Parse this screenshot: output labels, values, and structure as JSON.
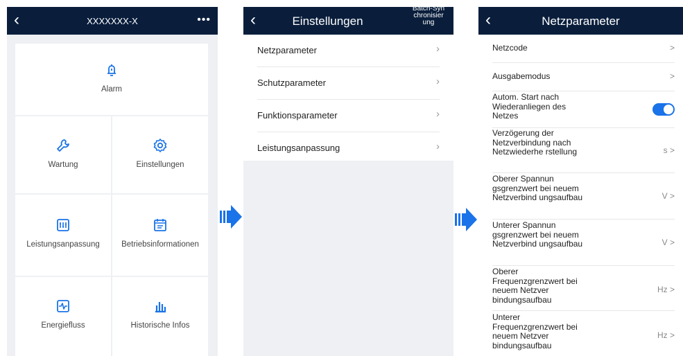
{
  "screen1": {
    "title": "XXXXXXX-X",
    "more_label": "•••",
    "tiles": [
      {
        "label": "Alarm",
        "icon": "alarm-bell-icon"
      },
      {
        "label": "Wartung",
        "icon": "wrench-icon"
      },
      {
        "label": "Einstellungen",
        "icon": "gear-icon"
      },
      {
        "label": "Leistungsanpassung",
        "icon": "sliders-icon"
      },
      {
        "label": "Betriebsinformationen",
        "icon": "calendar-icon"
      },
      {
        "label": "Energiefluss",
        "icon": "pulse-icon"
      },
      {
        "label": "Historische Infos",
        "icon": "bar-chart-icon"
      }
    ]
  },
  "screen2": {
    "title": "Einstellungen",
    "batch_label": "Batch-Syn chronisier ung",
    "items": [
      {
        "label": "Netzparameter"
      },
      {
        "label": "Schutzparameter"
      },
      {
        "label": "Funktionsparameter"
      },
      {
        "label": "Leistungsanpassung"
      }
    ]
  },
  "screen3": {
    "title": "Netzparameter",
    "items": [
      {
        "label": "Netzcode",
        "suffix": ">"
      },
      {
        "label": "Ausgabemodus",
        "suffix": ">"
      },
      {
        "label": "Autom. Start nach Wiederanliegen des Netzes",
        "suffix": "",
        "toggle_on": true
      },
      {
        "label": "Verzögerung der Netzverbindung nach Netzwiederhe rstellung",
        "suffix": "s >"
      },
      {
        "label": "Oberer Spannun gsgrenzwert bei neuem Netzverbind ungsaufbau",
        "suffix": "V >"
      },
      {
        "label": "Unterer Spannun gsgrenzwert bei neuem Netzverbind ungsaufbau",
        "suffix": "V >"
      },
      {
        "label": "Oberer Frequenzgrenzwert bei neuem Netzver bindungsaufbau",
        "suffix": "Hz >"
      },
      {
        "label": "Unterer Frequenzgrenzwert bei neuem Netzver bindungsaufbau",
        "suffix": "Hz >"
      }
    ]
  },
  "colors": {
    "header": "#0a1e3c",
    "accent": "#1a73e8",
    "panel_bg": "#eef0f3"
  },
  "icons": {
    "back": "back-chevron-icon",
    "arrow": "flow-arrow-icon"
  }
}
